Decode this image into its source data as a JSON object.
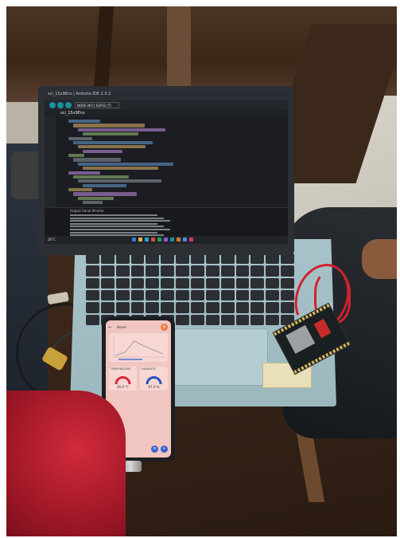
{
  "laptop": {
    "window_title": "sci_15x9Ens | Arduino IDE 2.3.2",
    "board_selector": "NODE MCU ESP32 (T)",
    "tab_label": "sci_15x9Ens",
    "output_label": "Output    Serial Monitor",
    "taskbar_weather": "26°C"
  },
  "phone_app": {
    "back_icon": "back-arrow-icon",
    "title": "Home",
    "add_label": "+",
    "gauge_left_label": "TEMPERATURE",
    "gauge_left_value": "26.0 °C",
    "gauge_right_label": "HUMIDITY",
    "gauge_right_value": "67.0 %",
    "fab_left": "≡",
    "fab_right": "+"
  },
  "colors": {
    "phone_screen": "#f1c6c0",
    "gauge_left": "#d9283a",
    "gauge_right": "#2b4fbf",
    "ide_accent": "#15919b"
  }
}
